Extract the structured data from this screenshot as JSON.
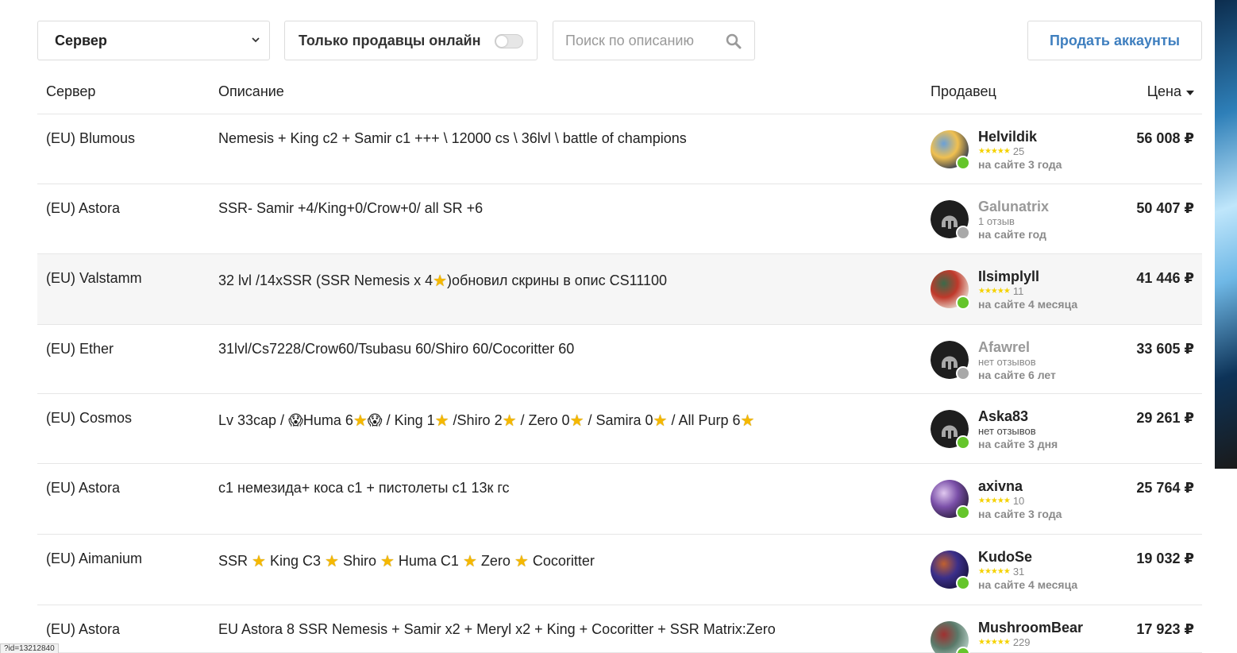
{
  "filters": {
    "server_select": "Сервер",
    "online_toggle_label": "Только продавцы онлайн",
    "online_only": false,
    "search_placeholder": "Поиск по описанию",
    "sell_button": "Продать аккаунты"
  },
  "table": {
    "headers": {
      "server": "Сервер",
      "description": "Описание",
      "seller": "Продавец",
      "price": "Цена"
    },
    "rows": [
      {
        "server": "(EU) Blumous",
        "description": "Nemesis + King c2 + Samir c1 +++ \\ 12000 cs \\ 36lvl \\ battle of champions",
        "seller": "Helvildik",
        "rating_count": "25",
        "reviews_text": "",
        "since": "на сайте 3 года",
        "online": true,
        "price": "56 008 ₽",
        "avatar": "anime-avatar"
      },
      {
        "server": "(EU) Astora",
        "description": "SSR- Samir +4/King+0/Crow+0/ all SR +6",
        "seller": "Galunatrix",
        "rating_count": "",
        "reviews_text": "1 отзыв",
        "since": "на сайте год",
        "online": false,
        "price": "50 407 ₽",
        "avatar": "helmet-avatar"
      },
      {
        "server": "(EU) Valstamm",
        "description_parts": [
          "32 lvl /14xSSR (SSR Nemesis x 4",
          "★",
          ")обновил скрины в опис CS11100"
        ],
        "seller": "Ilsimplyll",
        "rating_count": "11",
        "reviews_text": "",
        "since": "на сайте 4 месяца",
        "online": true,
        "price": "41 446 ₽",
        "avatar": "anime-avatar"
      },
      {
        "server": "(EU) Ether",
        "description": "31lvl/Cs7228/Crow60/Tsubasu 60/Shiro 60/Cocoritter 60",
        "seller": "Afawrel",
        "rating_count": "",
        "reviews_text": "нет отзывов",
        "since": "на сайте 6 лет",
        "online": false,
        "price": "33 605 ₽",
        "avatar": "helmet-avatar"
      },
      {
        "server": "(EU) Cosmos",
        "description_parts": [
          "Lv 33cap / ",
          "😱",
          "Huma 6",
          "★",
          "😱",
          " / King 1",
          "★",
          " /Shiro 2",
          "★",
          " / Zero 0",
          "★",
          " / Samira 0",
          "★",
          " / All Purp 6",
          "★"
        ],
        "seller": "Aska83",
        "rating_count": "",
        "reviews_text": "нет отзывов",
        "since": "на сайте 3 дня",
        "online": true,
        "price": "29 261 ₽",
        "avatar": "helmet-avatar"
      },
      {
        "server": "(EU) Astora",
        "description": "с1 немезида+ коса с1 + пистолеты с1 13к гс",
        "seller": "axivna",
        "rating_count": "10",
        "reviews_text": "",
        "since": "на сайте 3 года",
        "online": true,
        "price": "25 764 ₽",
        "avatar": "anime-avatar"
      },
      {
        "server": "(EU) Aimanium",
        "description_parts": [
          "SSR ",
          "★",
          " King C3 ",
          "★",
          " Shiro ",
          "★",
          " Huma C1 ",
          "★",
          " Zero ",
          "★",
          " Cocoritter"
        ],
        "seller": "KudoSe",
        "rating_count": "31",
        "reviews_text": "",
        "since": "на сайте 4 месяца",
        "online": true,
        "price": "19 032 ₽",
        "avatar": "anime-avatar"
      },
      {
        "server": "(EU) Astora",
        "description": "EU Astora 8 SSR Nemesis + Samir x2 + Meryl x2 + King + Cocoritter + SSR Matrix:Zero",
        "seller": "MushroomBear",
        "rating_count": "229",
        "reviews_text": "",
        "since": "",
        "online": true,
        "price": "17 923 ₽",
        "avatar": "anime-avatar"
      }
    ]
  },
  "status_bar": "?id=13212840",
  "colors": {
    "accent": "#3f7fbf",
    "online": "#65c52b",
    "offline": "#a9a9a9",
    "star": "#f5d200"
  }
}
